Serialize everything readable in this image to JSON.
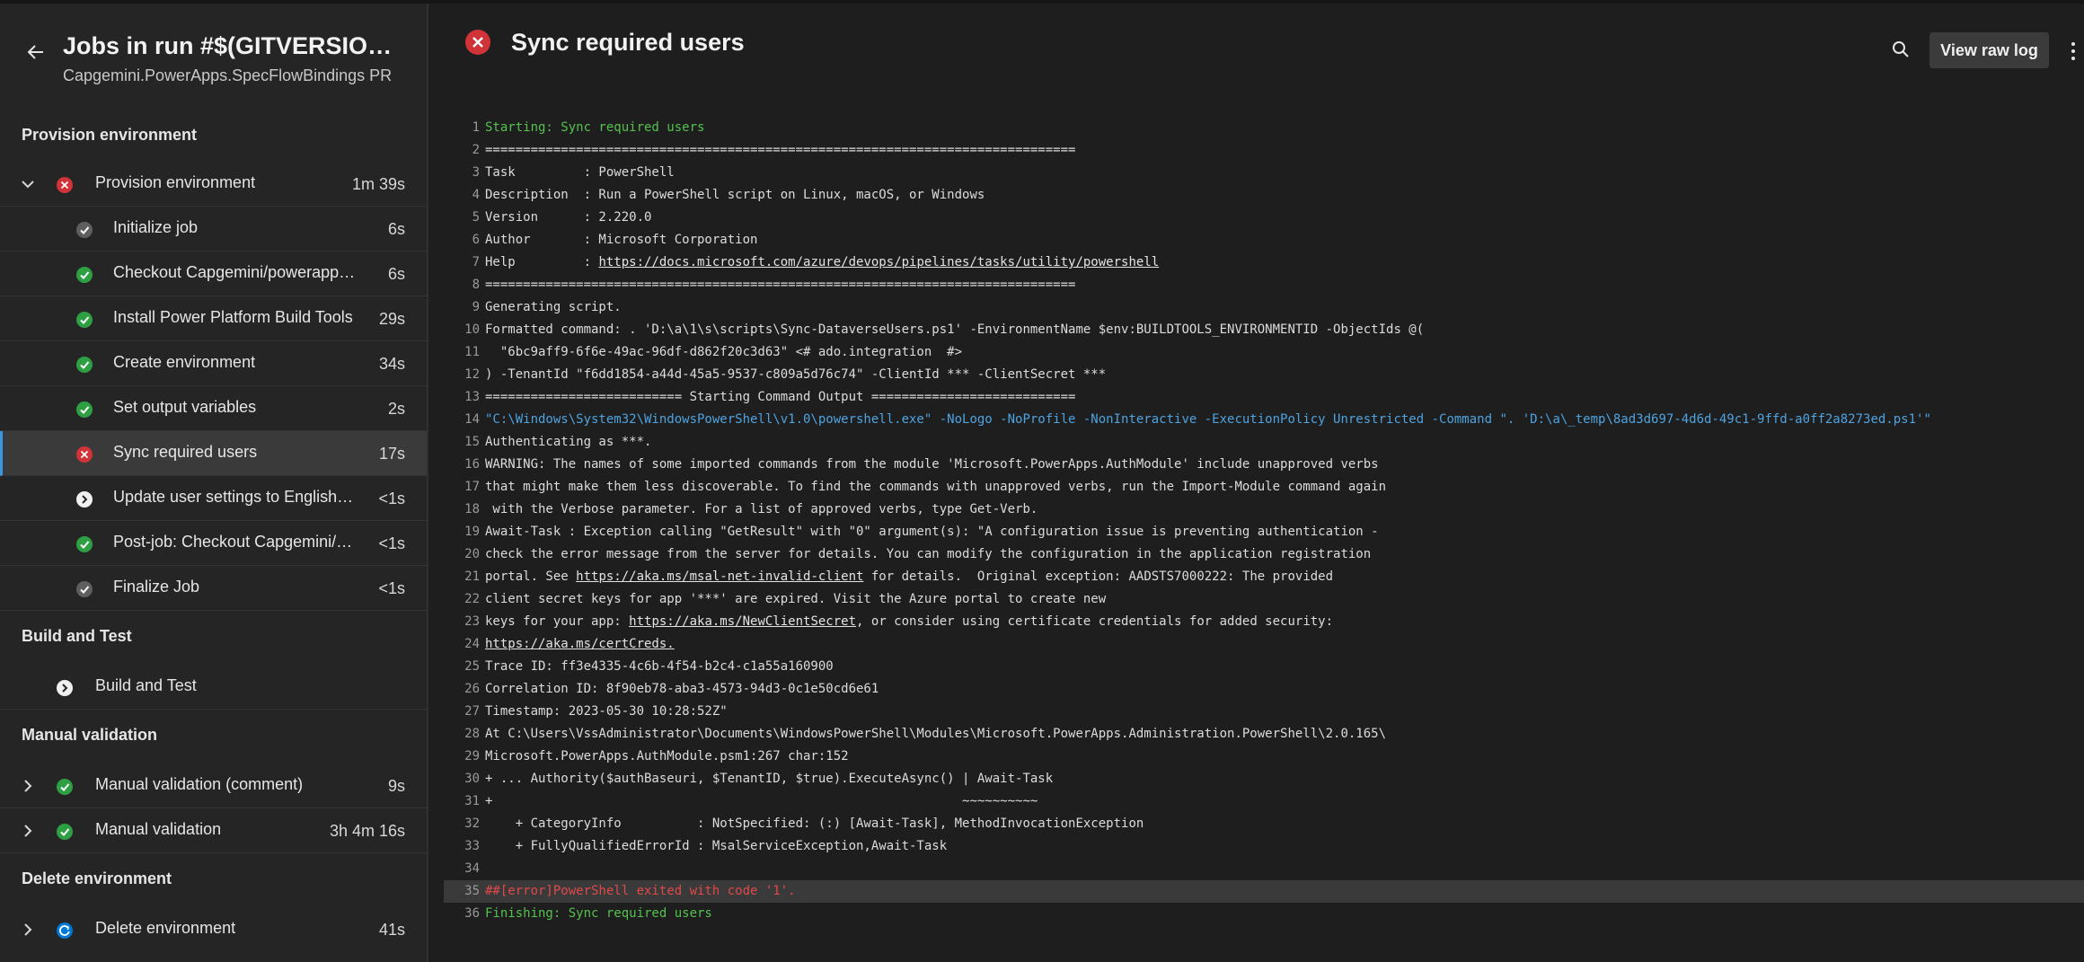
{
  "sidebar": {
    "title": "Jobs in run #$(GITVERSION_FULLSEMVER)",
    "subtitle": "Capgemini.PowerApps.SpecFlowBindings PR",
    "sections": [
      {
        "header": "Provision environment"
      },
      {
        "header": "Build and Test"
      },
      {
        "header": "Manual validation"
      },
      {
        "header": "Delete environment"
      }
    ],
    "jobs": {
      "provision": {
        "label": "Provision environment",
        "duration": "1m 39s"
      },
      "build": {
        "label": "Build and Test"
      },
      "manual_comment": {
        "label": "Manual validation (comment)",
        "duration": "9s"
      },
      "manual": {
        "label": "Manual validation",
        "duration": "3h 4m 16s"
      },
      "delete": {
        "label": "Delete environment",
        "duration": "41s"
      }
    },
    "steps": [
      {
        "label": "Initialize job",
        "duration": "6s"
      },
      {
        "label": "Checkout Capgemini/powerapps-specflow-bindings",
        "duration": "6s"
      },
      {
        "label": "Install Power Platform Build Tools",
        "duration": "29s"
      },
      {
        "label": "Create environment",
        "duration": "34s"
      },
      {
        "label": "Set output variables",
        "duration": "2s"
      },
      {
        "label": "Sync required users",
        "duration": "17s"
      },
      {
        "label": "Update user settings to English (United Kingdom)",
        "duration": "<1s"
      },
      {
        "label": "Post-job: Checkout Capgemini/powerapps-specflow-bindings",
        "duration": "<1s"
      },
      {
        "label": "Finalize Job",
        "duration": "<1s"
      }
    ]
  },
  "main": {
    "title": "Sync required users",
    "view_raw_log_label": "View raw log",
    "colors": {
      "error": "#d13438",
      "success": "#2ea043",
      "info": "#0078d4",
      "log_green": "#55c14f",
      "log_blue": "#4ea3e0",
      "log_red": "#e0494a"
    }
  },
  "log_lines": [
    {
      "n": "1",
      "t": "Starting: Sync required users",
      "k": "green"
    },
    {
      "n": "2",
      "t": "==============================================================================",
      "k": ""
    },
    {
      "n": "3",
      "t": "Task         : PowerShell",
      "k": ""
    },
    {
      "n": "4",
      "t": "Description  : Run a PowerShell script on Linux, macOS, or Windows",
      "k": ""
    },
    {
      "n": "5",
      "t": "Version      : 2.220.0",
      "k": ""
    },
    {
      "n": "6",
      "t": "Author       : Microsoft Corporation",
      "k": ""
    },
    {
      "n": "7",
      "t": "Help         : ",
      "link": "https://docs.microsoft.com/azure/devops/pipelines/tasks/utility/powershell",
      "k": ""
    },
    {
      "n": "8",
      "t": "==============================================================================",
      "k": ""
    },
    {
      "n": "9",
      "t": "Generating script.",
      "k": ""
    },
    {
      "n": "10",
      "t": "Formatted command: . 'D:\\a\\1\\s\\scripts\\Sync-DataverseUsers.ps1' -EnvironmentName $env:BUILDTOOLS_ENVIRONMENTID -ObjectIds @(",
      "k": ""
    },
    {
      "n": "11",
      "t": "  \"6bc9aff9-6f6e-49ac-96df-d862f20c3d63\" <# ado.integration  #>",
      "k": ""
    },
    {
      "n": "12",
      "t": ") -TenantId \"f6dd1854-a44d-45a5-9537-c809a5d76c74\" -ClientId *** -ClientSecret ***",
      "k": ""
    },
    {
      "n": "13",
      "t": "========================== Starting Command Output ===========================",
      "k": ""
    },
    {
      "n": "14",
      "t": "\"C:\\Windows\\System32\\WindowsPowerShell\\v1.0\\powershell.exe\" -NoLogo -NoProfile -NonInteractive -ExecutionPolicy Unrestricted -Command \". 'D:\\a\\_temp\\8ad3d697-4d6d-49c1-9ffd-a0ff2a8273ed.ps1'\"",
      "k": "cmd"
    },
    {
      "n": "15",
      "t": "Authenticating as ***.",
      "k": ""
    },
    {
      "n": "16",
      "t": "WARNING: The names of some imported commands from the module 'Microsoft.PowerApps.AuthModule' include unapproved verbs",
      "k": ""
    },
    {
      "n": "17",
      "t": "that might make them less discoverable. To find the commands with unapproved verbs, run the Import-Module command again",
      "k": ""
    },
    {
      "n": "18",
      "t": " with the Verbose parameter. For a list of approved verbs, type Get-Verb.",
      "k": ""
    },
    {
      "n": "19",
      "t": "Await-Task : Exception calling \"GetResult\" with \"0\" argument(s): \"A configuration issue is preventing authentication -",
      "k": ""
    },
    {
      "n": "20",
      "t": "check the error message from the server for details. You can modify the configuration in the application registration",
      "k": ""
    },
    {
      "n": "21",
      "t": "portal. See ",
      "link": "https://aka.ms/msal-net-invalid-client",
      "after": " for details.  Original exception: AADSTS7000222: The provided",
      "k": ""
    },
    {
      "n": "22",
      "t": "client secret keys for app '***' are expired. Visit the Azure portal to create new",
      "k": ""
    },
    {
      "n": "23",
      "t": "keys for your app: ",
      "link": "https://aka.ms/NewClientSecret",
      "after": ", or consider using certificate credentials for added security:",
      "k": ""
    },
    {
      "n": "24",
      "t": "",
      "link": "https://aka.ms/certCreds.",
      "k": ""
    },
    {
      "n": "25",
      "t": "Trace ID: ff3e4335-4c6b-4f54-b2c4-c1a55a160900",
      "k": ""
    },
    {
      "n": "26",
      "t": "Correlation ID: 8f90eb78-aba3-4573-94d3-0c1e50cd6e61",
      "k": ""
    },
    {
      "n": "27",
      "t": "Timestamp: 2023-05-30 10:28:52Z\"",
      "k": ""
    },
    {
      "n": "28",
      "t": "At C:\\Users\\VssAdministrator\\Documents\\WindowsPowerShell\\Modules\\Microsoft.PowerApps.Administration.PowerShell\\2.0.165\\",
      "k": ""
    },
    {
      "n": "29",
      "t": "Microsoft.PowerApps.AuthModule.psm1:267 char:152",
      "k": ""
    },
    {
      "n": "30",
      "t": "+ ... Authority($authBaseuri, $TenantID, $true).ExecuteAsync() | Await-Task",
      "k": ""
    },
    {
      "n": "31",
      "t": "+                                                              ~~~~~~~~~~",
      "k": ""
    },
    {
      "n": "32",
      "t": "    + CategoryInfo          : NotSpecified: (:) [Await-Task], MethodInvocationException",
      "k": ""
    },
    {
      "n": "33",
      "t": "    + FullyQualifiedErrorId : MsalServiceException,Await-Task",
      "k": ""
    },
    {
      "n": "34",
      "t": "",
      "k": ""
    },
    {
      "n": "35",
      "t": "##[error]PowerShell exited with code '1'.",
      "k": "err"
    },
    {
      "n": "36",
      "t": "Finishing: Sync required users",
      "k": "green"
    }
  ]
}
